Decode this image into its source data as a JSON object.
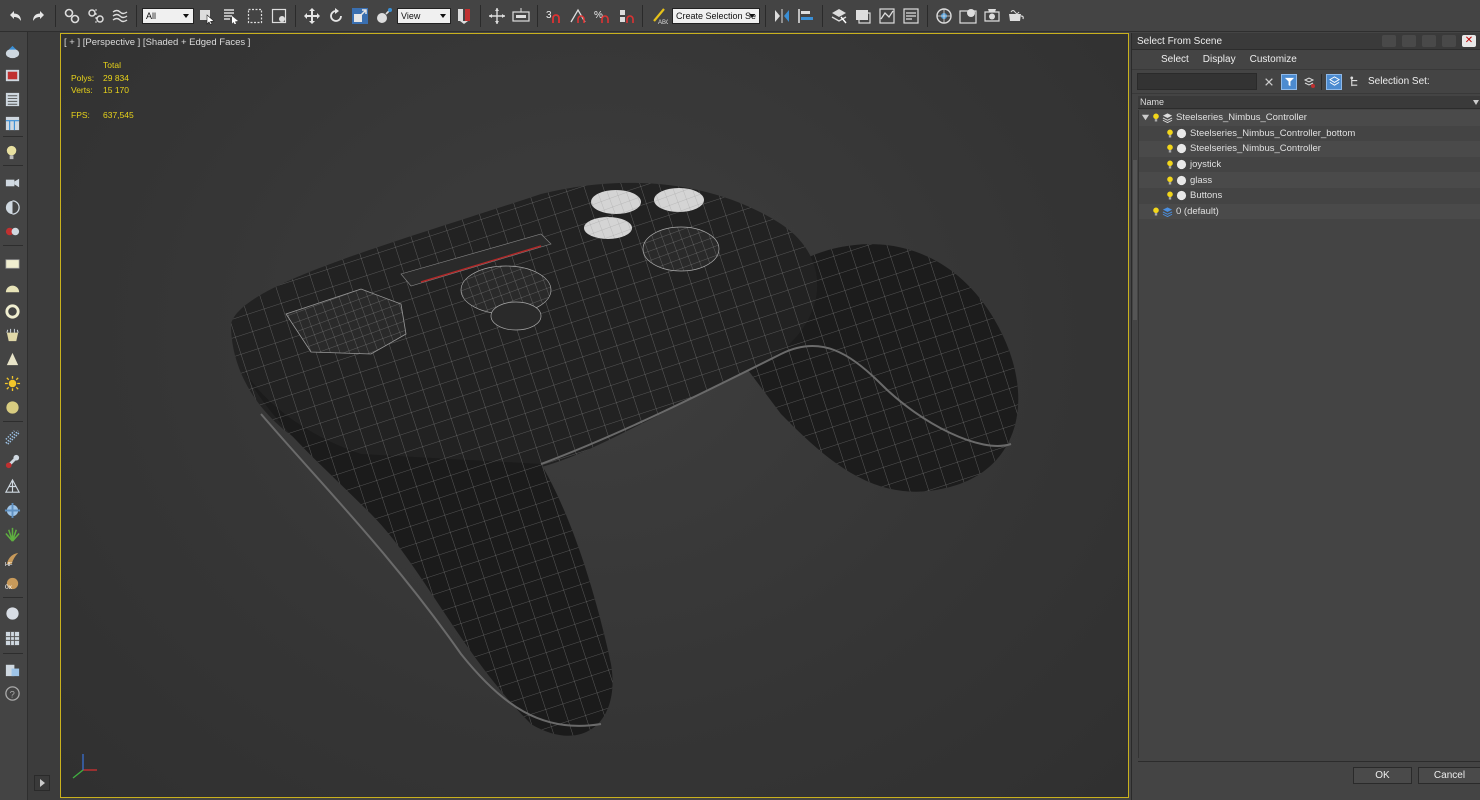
{
  "toolbar": {
    "filter_value": "All",
    "coord_value": "View",
    "selection_set_value": "Create Selection Se",
    "icons": [
      "undo-icon",
      "redo-icon",
      "link-icon",
      "unlink-icon",
      "bind-spacewarp-icon",
      "select-object-icon",
      "select-by-name-icon",
      "rect-selection-icon",
      "window-crossing-icon",
      "move-icon",
      "rotate-icon",
      "scale-icon",
      "place-icon",
      "pivot-icon",
      "select-manipulate-icon",
      "keyboard-shortcut-icon",
      "snap-3d-icon",
      "angle-snap-icon",
      "percent-snap-icon",
      "spinner-snap-icon",
      "edit-named-sets-icon",
      "mirror-icon",
      "align-icon",
      "scene-explorer-icon",
      "layer-explorer-icon",
      "toggle-ribbon-icon",
      "curve-editor-icon",
      "schematic-view-icon",
      "material-editor-icon",
      "render-setup-icon",
      "render-frame-icon",
      "render-icon"
    ]
  },
  "left_panel": {
    "icons": [
      "create-icon",
      "modify-icon",
      "hierarchy-icon",
      "motion-icon",
      "light-icon",
      "camera-icon",
      "helpers-icon",
      "spacewarp-icon",
      "plane-icon",
      "sphere-icon",
      "torus-icon",
      "tube-icon",
      "cone-icon",
      "sun-icon",
      "geosphere-icon",
      "particles-icon",
      "bones-icon",
      "patch-grid-icon",
      "dynamics-icon",
      "foliage-icon",
      "hair-icon",
      "xref-icon",
      "material-ball-icon",
      "grid-icon",
      "utilities-icon",
      "help-icon"
    ]
  },
  "viewport": {
    "label": "[ + ] [Perspective ] [Shaded + Edged Faces ]",
    "stats": {
      "total_label": "Total",
      "polys_label": "Polys:",
      "polys_value": "29 834",
      "verts_label": "Verts:",
      "verts_value": "15 170",
      "fps_label": "FPS:",
      "fps_value": "637,545"
    },
    "accent": "#c9b11d"
  },
  "scene_explorer": {
    "title": "Select From Scene",
    "menu": [
      "Select",
      "Display",
      "Customize"
    ],
    "selection_set_label": "Selection Set:",
    "column_name": "Name",
    "tree": [
      {
        "label": "Steelseries_Nimbus_Controller",
        "type": "layer",
        "expanded": true
      },
      {
        "label": "Steelseries_Nimbus_Controller_bottom",
        "type": "object"
      },
      {
        "label": "Steelseries_Nimbus_Controller",
        "type": "object"
      },
      {
        "label": "joystick",
        "type": "object"
      },
      {
        "label": "glass",
        "type": "object"
      },
      {
        "label": "Buttons",
        "type": "object"
      },
      {
        "label": "0 (default)",
        "type": "layer",
        "expanded": false
      }
    ],
    "ok_label": "OK",
    "cancel_label": "Cancel"
  }
}
